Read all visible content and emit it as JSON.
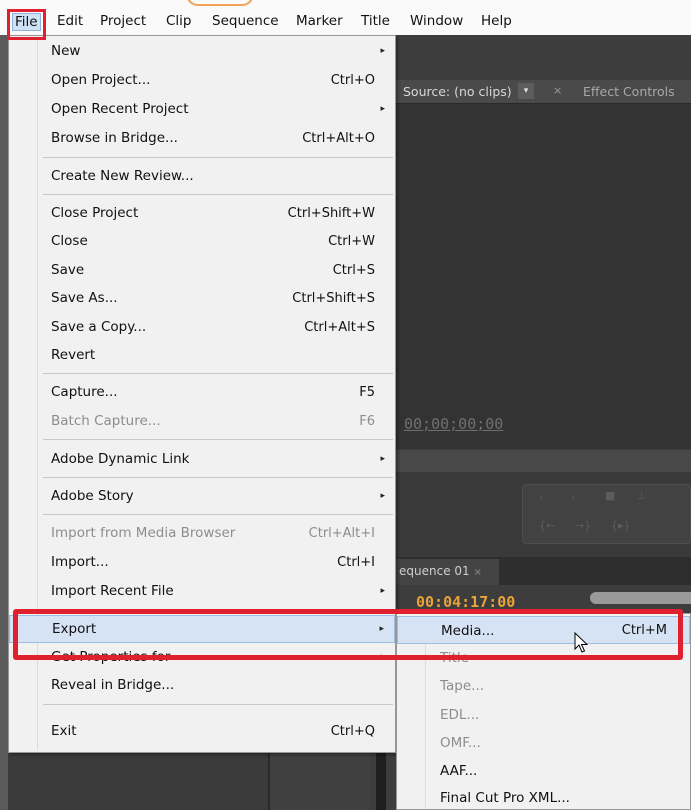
{
  "menubar": {
    "items": [
      {
        "label": "File",
        "active": true
      },
      {
        "label": "Edit"
      },
      {
        "label": "Project"
      },
      {
        "label": "Clip"
      },
      {
        "label": "Sequence"
      },
      {
        "label": "Marker"
      },
      {
        "label": "Title"
      },
      {
        "label": "Window"
      },
      {
        "label": "Help"
      }
    ]
  },
  "file_menu": {
    "items": [
      {
        "label": "New",
        "submenu": true
      },
      {
        "label": "Open Project...",
        "shortcut": "Ctrl+O"
      },
      {
        "label": "Open Recent Project",
        "submenu": true
      },
      {
        "label": "Browse in Bridge...",
        "shortcut": "Ctrl+Alt+O"
      },
      {
        "label": "Create New Review..."
      },
      {
        "label": "Close Project",
        "shortcut": "Ctrl+Shift+W"
      },
      {
        "label": "Close",
        "shortcut": "Ctrl+W"
      },
      {
        "label": "Save",
        "shortcut": "Ctrl+S"
      },
      {
        "label": "Save As...",
        "shortcut": "Ctrl+Shift+S"
      },
      {
        "label": "Save a Copy...",
        "shortcut": "Ctrl+Alt+S"
      },
      {
        "label": "Revert"
      },
      {
        "label": "Capture...",
        "shortcut": "F5"
      },
      {
        "label": "Batch Capture...",
        "shortcut": "F6",
        "disabled": true
      },
      {
        "label": "Adobe Dynamic Link",
        "submenu": true
      },
      {
        "label": "Adobe Story",
        "submenu": true
      },
      {
        "label": "Import from Media Browser",
        "shortcut": "Ctrl+Alt+I",
        "disabled": true
      },
      {
        "label": "Import...",
        "shortcut": "Ctrl+I"
      },
      {
        "label": "Import Recent File",
        "submenu": true
      },
      {
        "label": "Export",
        "submenu": true,
        "highlighted": true
      },
      {
        "label": "Get Properties for",
        "submenu": true
      },
      {
        "label": "Reveal in Bridge..."
      },
      {
        "label": "Exit",
        "shortcut": "Ctrl+Q"
      }
    ]
  },
  "export_submenu": {
    "items": [
      {
        "label": "Media...",
        "shortcut": "Ctrl+M",
        "highlighted": true
      },
      {
        "label": "Title",
        "disabled": true
      },
      {
        "label": "Tape...",
        "disabled": true
      },
      {
        "label": "EDL...",
        "disabled": true
      },
      {
        "label": "OMF...",
        "disabled": true
      },
      {
        "label": "AAF..."
      },
      {
        "label": "Final Cut Pro XML..."
      }
    ]
  },
  "panels": {
    "source_tab": "Source: (no clips)",
    "effect_controls_tab": "Effect Controls",
    "close_glyph": "×",
    "source_timecode": "00;00;00;00",
    "sequence_tab": "equence 01",
    "sequence_timecode": "00:04:17:00"
  },
  "icons": {
    "submenu_arrow": "▸",
    "dropdown_arrow": "▾",
    "cursor": "arrow-pointer-icon"
  },
  "colors": {
    "annotation_red": "#e0202e",
    "highlight_blue": "#d5e3f5",
    "timecode_orange": "#e8a33a"
  }
}
